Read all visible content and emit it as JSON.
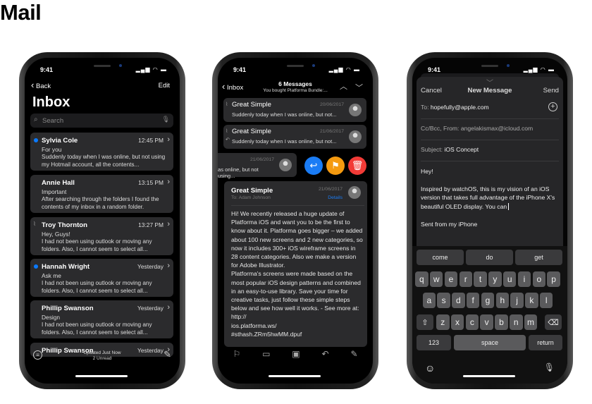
{
  "app_title": "Mail",
  "status": {
    "time": "9:41",
    "icons": "▂▄▆ ◠ ▬"
  },
  "inbox": {
    "back": "Back",
    "edit": "Edit",
    "title": "Inbox",
    "search_placeholder": "Search",
    "messages": [
      {
        "sender": "Sylvia Cole",
        "time": "12:45 PM",
        "subject": "For you",
        "preview": "Suddenly today when I was online, but not using my Hotmail account, all the contents...",
        "unread": true,
        "attachment": false
      },
      {
        "sender": "Annie Hall",
        "time": "13:15 PM",
        "subject": "Important",
        "preview": "After searching through the folders I found the contents of my inbox in a random folder.",
        "unread": false,
        "attachment": false
      },
      {
        "sender": "Troy Thornton",
        "time": "13:27 PM",
        "subject": "Hey, Guys!",
        "preview": "I had not been using outlook or moving any folders. Also, I cannot seem to select all...",
        "unread": false,
        "attachment": true
      },
      {
        "sender": "Hannah Wright",
        "time": "Yesterday",
        "subject": "Ask me",
        "preview": "I had not been using outlook or moving any folders. Also, I cannot seem to select all...",
        "unread": true,
        "attachment": false
      },
      {
        "sender": "Phillip Swanson",
        "time": "Yesterday",
        "subject": "Design",
        "preview": "I had not been using outlook or moving any folders. Also, I cannot seem to select all...",
        "unread": false,
        "attachment": false
      },
      {
        "sender": "Phillip Swanson",
        "time": "Yesterday",
        "subject": "",
        "preview": "",
        "unread": false,
        "attachment": false
      }
    ],
    "toolbar": {
      "updated": "Updated Just Now",
      "unread": "2 Unread"
    }
  },
  "thread": {
    "back": "Inbox",
    "title": "6 Messages",
    "subtitle": "You bought Platforma Bundle:...",
    "messages": [
      {
        "sender": "Great Simple",
        "date": "20/06/2017",
        "preview": "Suddenly today when I was online, but not..."
      },
      {
        "sender": "Great Simple",
        "date": "21/06/2017",
        "preview": "Suddenly today when I was online, but not..."
      },
      {
        "sender": "",
        "date": "21/06/2017",
        "preview": "as online, but not using..."
      }
    ],
    "swipe_actions": [
      {
        "icon": "reply-icon",
        "color": "#1a7cf5"
      },
      {
        "icon": "flag-icon",
        "color": "#f59a10"
      },
      {
        "icon": "trash-icon",
        "color": "#f23b37"
      }
    ],
    "open": {
      "sender": "Great Simple",
      "date": "21/06/2017",
      "to_label": "To:",
      "to": "Adam Johnson",
      "details": "Details",
      "body": "Hi! We recently released a huge update of Platforma iOS and want you to be the first to know about it. Platforma goes bigger – we added about 100 new screens and 2 new categories, so now it includes 300+ iOS wireframe screens in 28 content categories. Also we make a version for Adobe Illustrator.\nPlatforma's screens were made based on the most popular iOS design patterns and combined in an easy-to-use library. Save your time for creative tasks, just follow these simple steps below and see how well it works. - See more at: http://\nios.platforma.ws/\n#sthash.ZRm5hwMM.dpuf"
    }
  },
  "compose": {
    "cancel": "Cancel",
    "title": "New Message",
    "send": "Send",
    "to_label": "To:",
    "to": "hopefully@apple.com",
    "cc_label": "Cc/Bcc, From:",
    "cc": "angelakismax@icloud.com",
    "subject_label": "Subject:",
    "subject": "iOS Concept",
    "greeting": "Hey!",
    "body": "Inspired by watchOS, this is my vision of an iOS version that takes full advantage of the iPhone X's beautiful OLED display. You can",
    "signature": "Sent from my iPhone",
    "suggestions": [
      "come",
      "do",
      "get"
    ],
    "rows": [
      [
        "q",
        "w",
        "e",
        "r",
        "t",
        "y",
        "u",
        "i",
        "o",
        "p"
      ],
      [
        "a",
        "s",
        "d",
        "f",
        "g",
        "h",
        "j",
        "k",
        "l"
      ],
      [
        "z",
        "x",
        "c",
        "v",
        "b",
        "n",
        "m"
      ]
    ],
    "numbers": "123",
    "space": "space",
    "return": "return"
  },
  "colors": {
    "accent": "#0a7aff",
    "card": "#2b2b2d"
  }
}
